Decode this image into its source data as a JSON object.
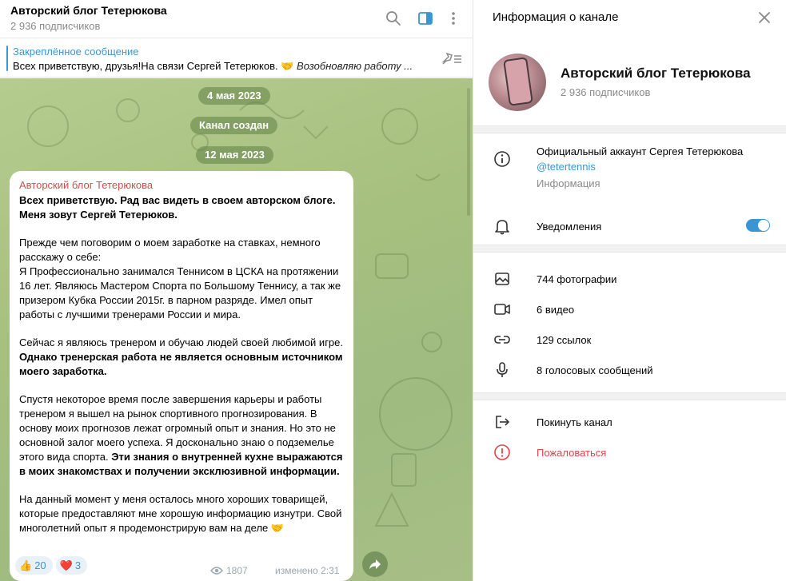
{
  "chat": {
    "title": "Авторский блог Тетерюкова",
    "subscribers": "2 936 подписчиков"
  },
  "pinned": {
    "title": "Закреплённое сообщение",
    "text": "Всех приветствую, друзья!На связи Сергей Тетерюков. 🤝 ",
    "text_italic": "Возобновляю работу ..."
  },
  "dates": [
    "4 мая 2023",
    "Канал создан",
    "12 мая 2023"
  ],
  "message": {
    "author": "Авторский блог Тетерюкова",
    "p1": "Всех приветствую. Рад вас видеть в своем авторском блоге. Меня зовут Сергей Тетерюков.",
    "p2": "Прежде чем поговорим о моем заработке на ставках, немного расскажу о себе:",
    "p3": "Я Профессионально занимался Теннисом в ЦСКА на протяжении 16 лет. Являюсь Мастером Спорта по Большому Теннису, а так же призером Кубка России 2015г. в парном разряде. Имел опыт работы с лучшими тренерами России и мира.",
    "p4_a": "Сейчас я являюсь тренером и обучаю людей своей любимой игре. ",
    "p4_b": "Однако тренерская работа не является основным источником моего заработка.",
    "p5_a": "Спустя некоторое время после завершения карьеры и работы тренером я вышел на рынок спортивного прогнозирования. В основу моих прогнозов лежат огромный опыт и знания. Но это не основной залог моего успеха. Я досконально знаю о подземелье этого вида спорта. ",
    "p5_b": "Эти знания о внутренней кухне выражаются в моих знакомствах и получении эксклюзивной информации.",
    "p6": "На данный момент у меня осталось много хороших товарищей, которые предоставляют мне хорошую информацию изнутри. Свой многолетний опыт я продемонстрирую вам на деле 🤝",
    "reactions": [
      {
        "emoji": "👍",
        "count": "20"
      },
      {
        "emoji": "❤️",
        "count": "3"
      }
    ],
    "views": "1807",
    "edited": "изменено 2:31"
  },
  "info": {
    "title": "Информация о канале",
    "channel_name": "Авторский блог Тетерюкова",
    "subscribers": "2 936 подписчиков",
    "description": "Официальный аккаунт Сергея Тетерюкова",
    "username": "@tetertennis",
    "description_label": "Информация",
    "notifications": "Уведомления",
    "notifications_on": true,
    "media": {
      "photos": "744 фотографии",
      "videos": "6 видео",
      "links": "129 ссылок",
      "voice": "8 голосовых сообщений"
    },
    "leave": "Покинуть канал",
    "report": "Пожаловаться"
  },
  "colors": {
    "accent": "#3a95d5",
    "author": "#d14c4c",
    "danger": "#e0434a",
    "chat_bg": "#a6c07f"
  }
}
